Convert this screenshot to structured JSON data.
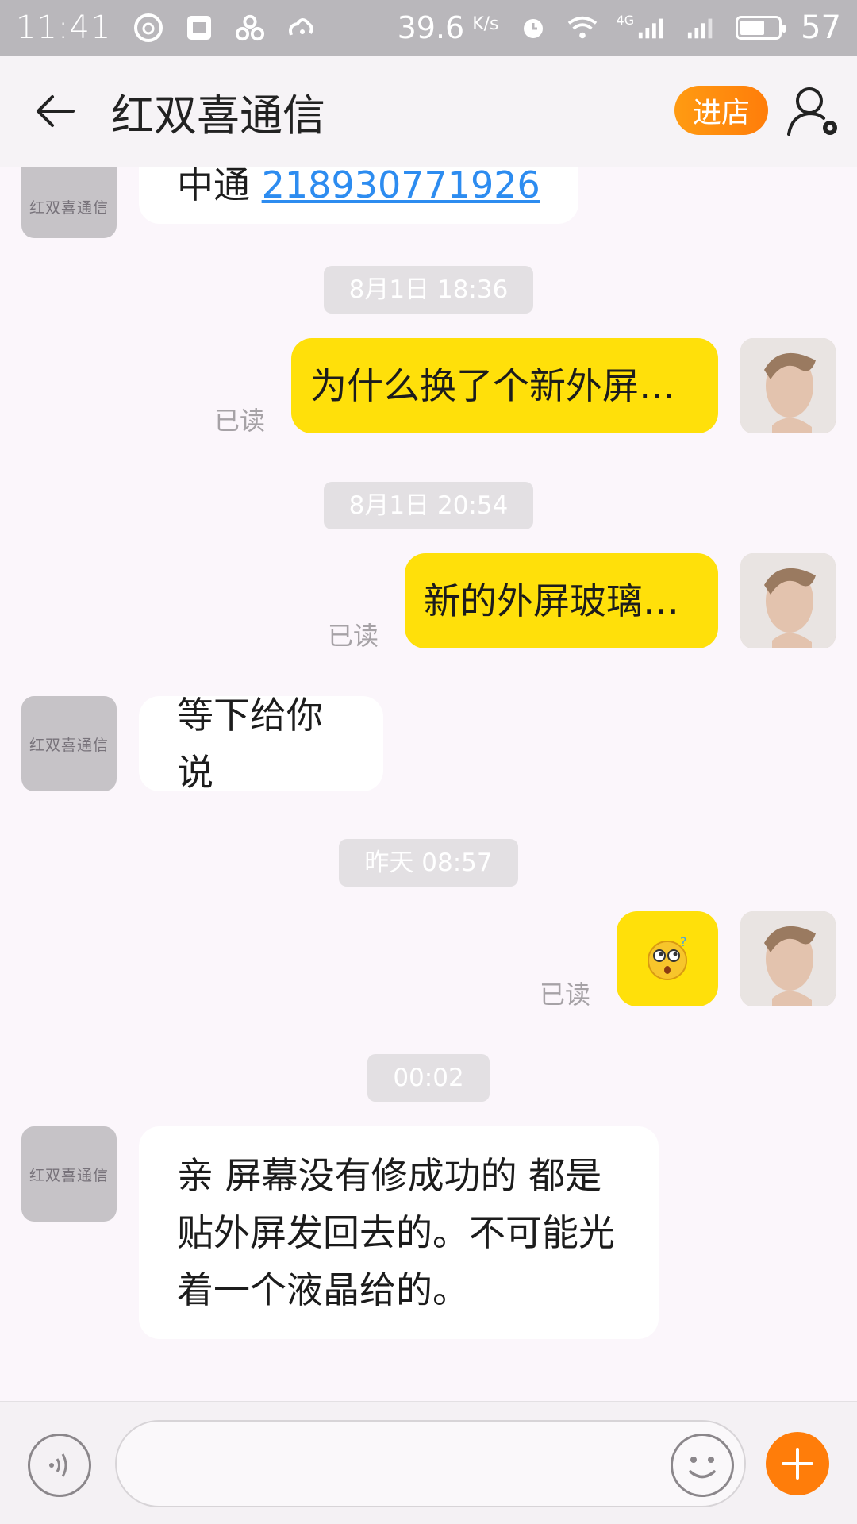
{
  "status_bar": {
    "time": "11:41",
    "net_speed": "39.6",
    "net_unit": "K/s",
    "network": "4G",
    "battery": "57"
  },
  "header": {
    "title": "红双喜通信",
    "shop_label": "进店"
  },
  "shop_avatar_text": "红双喜通信",
  "messages": {
    "m0_prefix": "中通 ",
    "m0_link": "218930771926",
    "ts1": "8月1日 18:36",
    "m1": "为什么换了个新外屏…",
    "read1": "已读",
    "ts2": "8月1日 20:54",
    "m2": "新的外屏玻璃…",
    "read2": "已读",
    "m3": "等下给你说",
    "ts3": "昨天 08:57",
    "read3": "已读",
    "ts4": "00:02",
    "m5_line1": "亲 屏幕没有修成功的 都是",
    "m5_line2": "贴外屏发回去的。不可能光",
    "m5_line3": "着一个液晶给的。"
  },
  "colors": {
    "accent_orange": "#ff7d0a",
    "bubble_out": "#ffe00a",
    "bubble_in": "#ffffff",
    "status_bar": "#b9b7bb"
  },
  "icons": [
    "back-arrow-icon",
    "profile-settings-icon",
    "voice-icon",
    "emoji-icon",
    "plus-icon",
    "confused-emoji-icon"
  ]
}
